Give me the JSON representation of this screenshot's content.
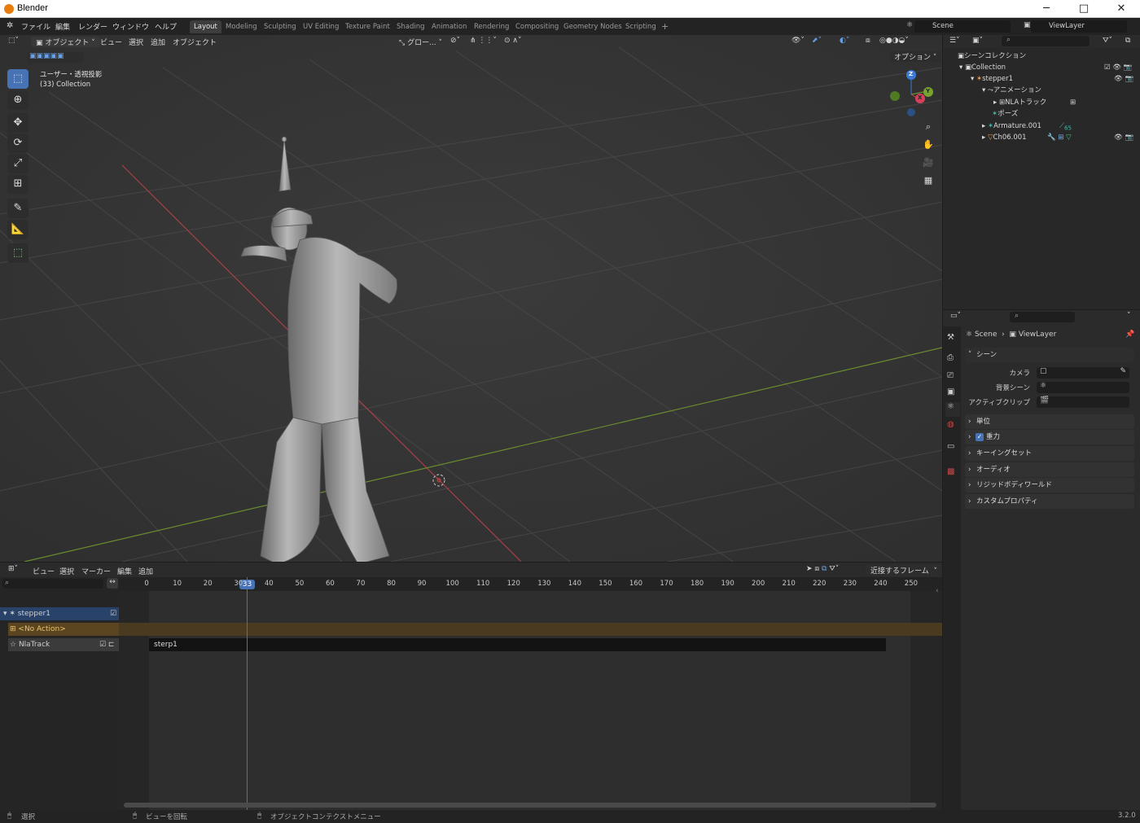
{
  "window": {
    "title": "Blender",
    "controls": [
      "─",
      "□",
      "✕"
    ]
  },
  "topbar": {
    "menus": [
      "ファイル",
      "編集",
      "レンダー",
      "ウィンドウ",
      "ヘルプ"
    ],
    "workspace_tabs": [
      "Layout",
      "Modeling",
      "Sculpting",
      "UV Editing",
      "Texture Paint",
      "Shading",
      "Animation",
      "Rendering",
      "Compositing",
      "Geometry Nodes",
      "Scripting"
    ],
    "active_tab": "Layout",
    "add_tab": "+",
    "scene": "Scene",
    "view_layer": "ViewLayer"
  },
  "viewport_header": {
    "mode": "オブジェクト",
    "menus": [
      "ビュー",
      "選択",
      "追加",
      "オブジェクト"
    ],
    "transform_orientation": "グロー...",
    "options": "オプション"
  },
  "viewport": {
    "view_name": "ユーザー・透視投影",
    "collection_info": "(33) Collection",
    "gizmo_axes": {
      "z": "Z",
      "y": "Y",
      "x": "X"
    }
  },
  "outliner": {
    "title": "シーンコレクション",
    "items": [
      {
        "label": "Collection",
        "depth": 1
      },
      {
        "label": "stepper1",
        "depth": 2
      },
      {
        "label": "アニメーション",
        "depth": 3
      },
      {
        "label": "NLAトラック",
        "depth": 4
      },
      {
        "label": "ポーズ",
        "depth": 3
      },
      {
        "label": "Armature.001",
        "depth": 3,
        "badge": "65"
      },
      {
        "label": "Ch06.001",
        "depth": 3
      }
    ]
  },
  "properties": {
    "breadcrumb": [
      "Scene",
      "ViewLayer"
    ],
    "panel": "シーン",
    "fields": [
      {
        "label": "カメラ"
      },
      {
        "label": "背景シーン"
      },
      {
        "label": "アクティブクリップ"
      }
    ],
    "sections": [
      "単位",
      "重力",
      "キーイングセット",
      "オーディオ",
      "リジッドボディワールド",
      "カスタムプロパティ"
    ],
    "gravity_checked": true
  },
  "nla": {
    "menus": [
      "ビュー",
      "選択",
      "マーカー",
      "編集",
      "追加"
    ],
    "snap": "近接するフレーム",
    "current_frame": "33",
    "ticks": [
      "0",
      "10",
      "20",
      "30",
      "40",
      "50",
      "60",
      "70",
      "80",
      "90",
      "100",
      "110",
      "120",
      "130",
      "140",
      "150",
      "160",
      "170",
      "180",
      "190",
      "200",
      "210",
      "220",
      "230",
      "240",
      "250"
    ],
    "tracks": [
      {
        "name": "stepper1"
      },
      {
        "name": "<No Action>"
      },
      {
        "name": "NlaTrack"
      }
    ],
    "strip": "sterp1"
  },
  "status": {
    "items": [
      "選択",
      "ビューを回転",
      "オブジェクトコンテクストメニュー"
    ],
    "version": "3.2.0"
  },
  "colors": {
    "accent": "#4772b3",
    "x_axis": "#a8404a",
    "y_axis": "#6b8c2e",
    "nla_orange": "#4a3a1f"
  }
}
